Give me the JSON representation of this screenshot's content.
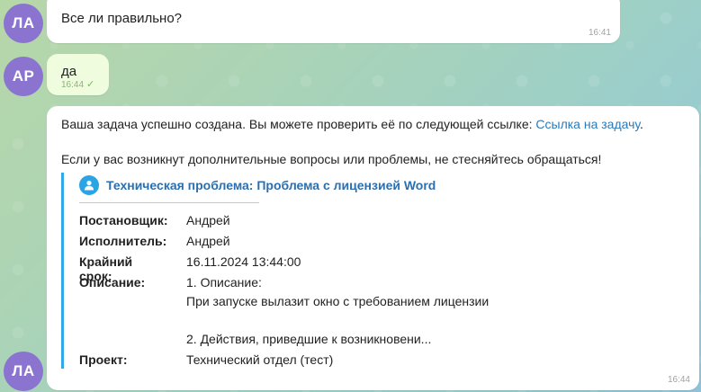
{
  "messages": [
    {
      "avatar": "ЛА",
      "text": "Все ли правильно?",
      "time": "16:41"
    },
    {
      "avatar": "АР",
      "text": "да",
      "time": "16:44",
      "status": "read"
    },
    {
      "avatar": "ЛА",
      "text_line1_prefix": "Ваша задача успешно создана. Вы можете проверить её по следующей ссылке: ",
      "text_line1_link": "Ссылка на задачу",
      "text_line1_suffix": ".",
      "text_line2": "Если у вас возникнут дополнительные вопросы или проблемы, не стесняйтесь обращаться!",
      "time": "16:44",
      "card": {
        "title": "Техническая проблема: Проблема с лицензией Word",
        "fields": [
          {
            "label": "Постановщик:",
            "value": "Андрей"
          },
          {
            "label": "Исполнитель:",
            "value": "Андрей"
          },
          {
            "label": "Крайний срок:",
            "value": "16.11.2024 13:44:00"
          },
          {
            "label": "Описание:",
            "value_lines": [
              "1. Описание:",
              "При запуске вылазит окно с требованием лицензии",
              "",
              "2. Действия, приведшие к возникновени..."
            ]
          },
          {
            "label": "Проект:",
            "value": "Технический отдел (тест)"
          }
        ]
      }
    }
  ],
  "colors": {
    "avatar": "#8b74d0",
    "accent": "#32a8e8",
    "link": "#2a7ab8"
  },
  "icons": {
    "card_icon": "user-icon",
    "read_status": "check-icon"
  }
}
